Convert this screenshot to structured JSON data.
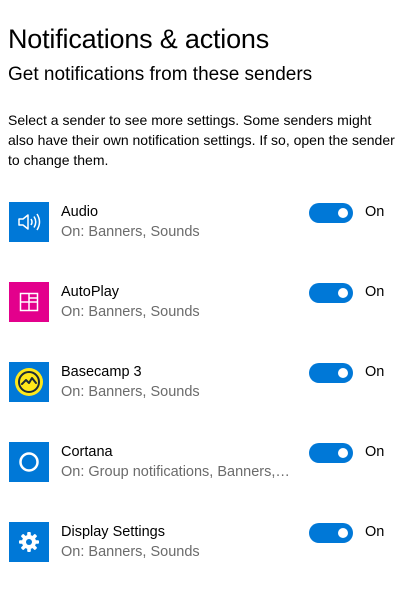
{
  "page": {
    "title": "Notifications & actions",
    "subtitle": "Get notifications from these senders",
    "description": "Select a sender to see more settings. Some senders might also have their own notification settings. If so, open the sender to change them."
  },
  "colors": {
    "accent": "#0078d7",
    "autoplay": "#e3008c",
    "basecamp_yellow": "#ffe81a"
  },
  "senders": [
    {
      "name": "Audio",
      "status": "On: Banners, Sounds",
      "toggle": "On",
      "enabled": true,
      "icon": "speaker-icon",
      "icon_bg": "#0078d7"
    },
    {
      "name": "AutoPlay",
      "status": "On: Banners, Sounds",
      "toggle": "On",
      "enabled": true,
      "icon": "autoplay-icon",
      "icon_bg": "#e3008c"
    },
    {
      "name": "Basecamp 3",
      "status": "On: Banners, Sounds",
      "toggle": "On",
      "enabled": true,
      "icon": "basecamp-icon",
      "icon_bg": "#0078d7"
    },
    {
      "name": "Cortana",
      "status": "On: Group notifications, Banners,…",
      "toggle": "On",
      "enabled": true,
      "icon": "cortana-icon",
      "icon_bg": "#0078d7"
    },
    {
      "name": "Display Settings",
      "status": "On: Banners, Sounds",
      "toggle": "On",
      "enabled": true,
      "icon": "gear-icon",
      "icon_bg": "#0078d7"
    }
  ]
}
